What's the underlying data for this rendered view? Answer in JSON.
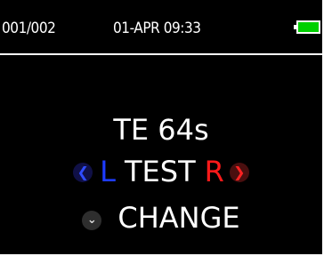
{
  "status_bar": {
    "record_counter": "001/002",
    "datetime": "01-APR 09:33",
    "battery_color": "#00d000"
  },
  "main": {
    "test_time": "TE 64s",
    "ear_selector": {
      "left_arrow_icon": "chevron-left-circle",
      "left_label": "L",
      "test_label": "TEST",
      "right_label": "R",
      "right_arrow_icon": "chevron-right-circle",
      "left_color": "#1e3cff",
      "right_color": "#ff1a1a"
    },
    "change": {
      "icon": "chevron-down-circle",
      "label": "CHANGE"
    }
  }
}
